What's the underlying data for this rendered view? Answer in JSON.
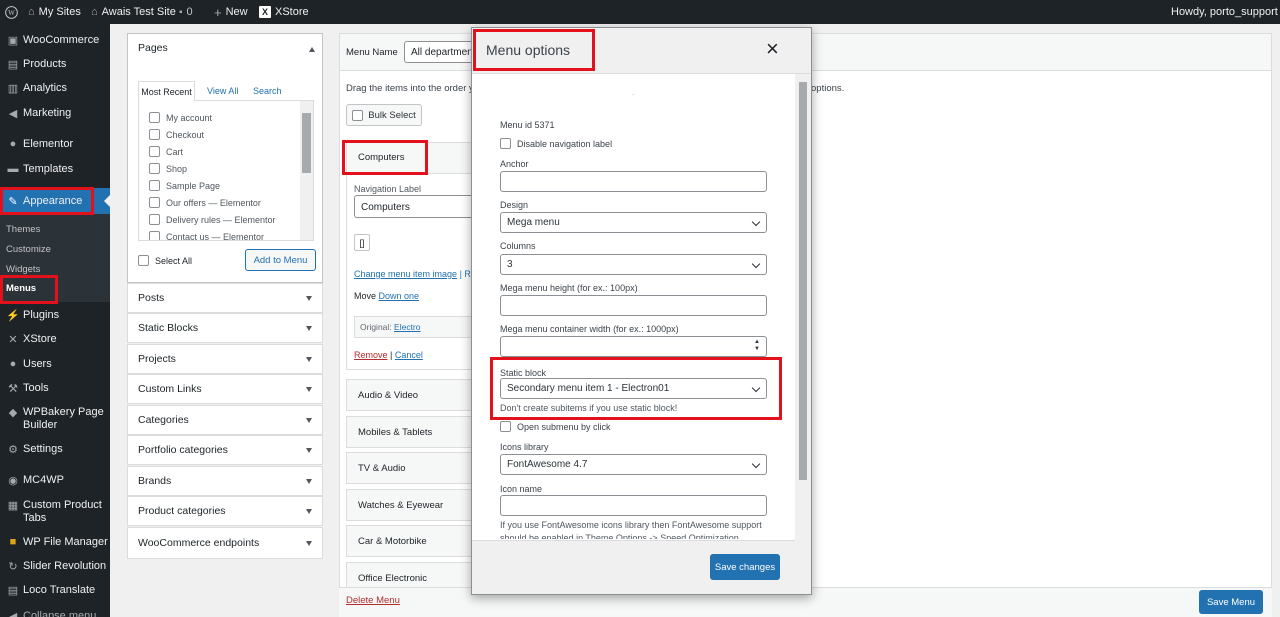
{
  "admin_bar": {
    "my_sites": "My Sites",
    "site_name": "Awais Test Site",
    "comments_count": "0",
    "new_label": "New",
    "theme": "XStore",
    "howdy": "Howdy, porto_support"
  },
  "sidebar": {
    "woocommerce": "WooCommerce",
    "products": "Products",
    "analytics": "Analytics",
    "marketing": "Marketing",
    "elementor": "Elementor",
    "templates": "Templates",
    "appearance": "Appearance",
    "themes": "Themes",
    "customize": "Customize",
    "widgets": "Widgets",
    "menus": "Menus",
    "plugins": "Plugins",
    "xstore": "XStore",
    "users": "Users",
    "tools": "Tools",
    "wpbakery_1": "WPBakery Page",
    "wpbakery_2": "Builder",
    "settings": "Settings",
    "mc4wp": "MC4WP",
    "custom_tabs_1": "Custom Product",
    "custom_tabs_2": "Tabs",
    "file_manager": "WP File Manager",
    "slider": "Slider Revolution",
    "loco": "Loco Translate",
    "collapse": "Collapse menu"
  },
  "add_items": {
    "pages_title": "Pages",
    "tabs": [
      "Most Recent",
      "View All",
      "Search"
    ],
    "pages": [
      "My account",
      "Checkout",
      "Cart",
      "Shop",
      "Sample Page",
      "Our offers — Elementor",
      "Delivery rules — Elementor",
      "Contact us — Elementor"
    ],
    "select_all": "Select All",
    "add_to_menu": "Add to Menu",
    "sections": [
      "Posts",
      "Static Blocks",
      "Projects",
      "Custom Links",
      "Categories",
      "Portfolio categories",
      "Brands",
      "Product categories",
      "WooCommerce endpoints"
    ]
  },
  "menu_structure": {
    "menu_name_label": "Menu Name",
    "menu_name_value": "All departments",
    "drag_text": "Drag the items into the order y",
    "drag_text_tail": "options.",
    "bulk_select": "Bulk Select",
    "item_title": "Computers",
    "nav_label_label": "Navigation Label",
    "nav_label_value": "Computers",
    "icon_glyph": "[]",
    "change_image": "Change menu item image",
    "change_image_sep": "| R",
    "move_label": "Move",
    "move_link": "Down one",
    "original_label": "Original:",
    "original_link": "Electro",
    "remove": "Remove",
    "link_sep": "|",
    "cancel": "Cancel",
    "items": [
      "Audio & Video",
      "Mobiles & Tablets",
      "TV & Audio",
      "Watches & Eyewear",
      "Car & Motorbike",
      "Office Electronic"
    ],
    "delete_menu": "Delete Menu",
    "save_menu": "Save Menu"
  },
  "modal": {
    "title": "Menu options",
    "close_glyph": "×",
    "dot": "-",
    "menu_id": "Menu id 5371",
    "disable_nav_label": "Disable navigation label",
    "anchor_label": "Anchor",
    "anchor_value": "",
    "design_label": "Design",
    "design_value": "Mega menu",
    "columns_label": "Columns",
    "columns_value": "3",
    "height_label": "Mega menu height (for ex.: 100px)",
    "width_label": "Mega menu container width (for ex.: 1000px)",
    "static_block_label": "Static block",
    "static_block_value": "Secondary menu item 1 - Electron01",
    "static_block_note": "Don't create subitems if you use static block!",
    "open_submenu": "Open submenu by click",
    "icons_library_label": "Icons library",
    "icons_library_value": "FontAwesome 4.7",
    "icon_name_label": "Icon name",
    "icon_note": "If you use FontAwesome icons library then FontAwesome support should be enabled in Theme Options -> Speed Optimization",
    "save_changes": "Save changes"
  },
  "colors": {
    "admin_dark": "#1d2327",
    "wp_blue": "#2271b1",
    "highlight_red": "#e3111c"
  }
}
